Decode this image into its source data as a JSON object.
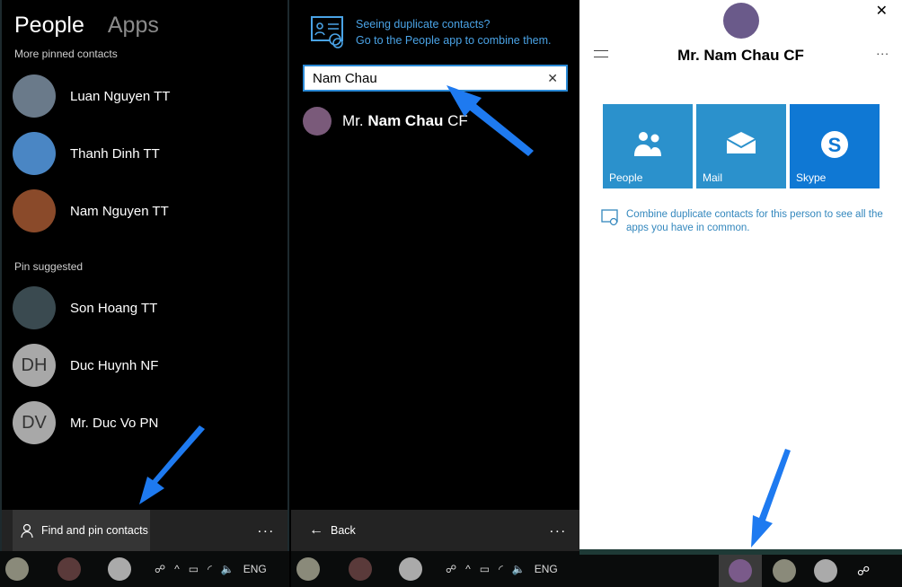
{
  "left": {
    "tabs": [
      {
        "label": "People",
        "active": true
      },
      {
        "label": "Apps",
        "active": false
      }
    ],
    "pinned_header": "More pinned contacts",
    "pinned": [
      {
        "name": "Luan Nguyen TT",
        "color": "#6a7a8a"
      },
      {
        "name": "Thanh Dinh TT",
        "color": "#4a86c4"
      },
      {
        "name": "Nam Nguyen TT",
        "color": "#8a4a2a"
      }
    ],
    "suggested_header": "Pin suggested",
    "suggested": [
      {
        "name": "Son Hoang TT",
        "color": "#3a4a50",
        "initials": ""
      },
      {
        "name": "Duc Huynh NF",
        "color": "#a8a8a8",
        "initials": "DH"
      },
      {
        "name": "Mr. Duc Vo PN",
        "color": "#a8a8a8",
        "initials": "DV"
      }
    ],
    "find_button": "Find and pin contacts",
    "more": "..."
  },
  "mid": {
    "banner_line1": "Seeing duplicate contacts?",
    "banner_line2": "Go to the People app to combine them.",
    "search_value": "Nam Chau",
    "result_prefix": "Mr. ",
    "result_match": "Nam Chau",
    "result_suffix": " CF",
    "back": "Back",
    "more": "..."
  },
  "right": {
    "name": "Mr. Nam Chau CF",
    "more": "...",
    "tiles": [
      {
        "label": "People",
        "icon": "people-icon",
        "color": "#2b91cc"
      },
      {
        "label": "Mail",
        "icon": "mail-icon",
        "color": "#2b91cc"
      },
      {
        "label": "Skype",
        "icon": "skype-icon",
        "color": "#0f78d4"
      }
    ],
    "combine_text": "Combine duplicate contacts for this person to see all the apps you have in common."
  },
  "taskbar": {
    "lang": "ENG"
  }
}
